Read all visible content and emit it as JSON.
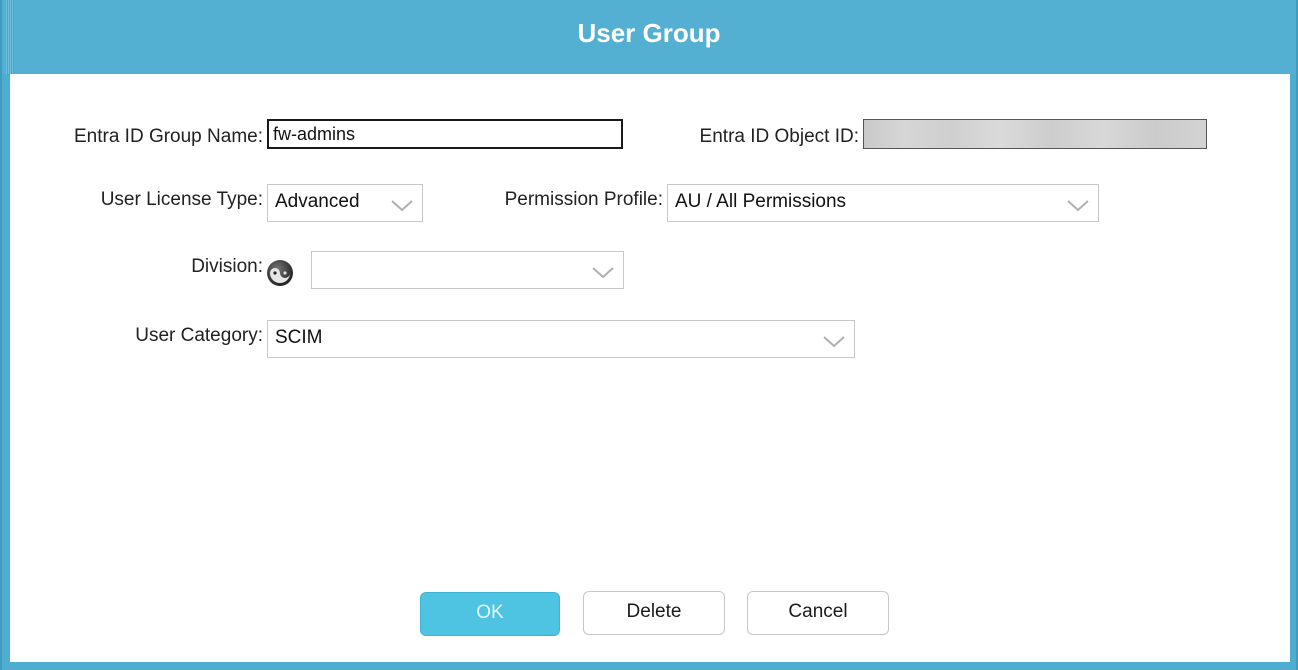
{
  "dialog": {
    "title": "User Group"
  },
  "form": {
    "group_name_label": "Entra ID Group Name:",
    "group_name_value": "fw-admins",
    "object_id_label": "Entra ID Object ID:",
    "license_label": "User License Type:",
    "license_value": "Advanced",
    "permission_label": "Permission Profile:",
    "permission_value": "AU / All Permissions",
    "division_label": "Division:",
    "division_value": "",
    "category_label": "User Category:",
    "category_value": "SCIM"
  },
  "buttons": {
    "ok": "OK",
    "delete": "Delete",
    "cancel": "Cancel"
  },
  "icons": {
    "division": "yin-yang-icon",
    "dropdown": "chevron-down-icon"
  },
  "colors": {
    "titlebar": "#54b0d2",
    "ok_button": "#4ec3e2"
  }
}
